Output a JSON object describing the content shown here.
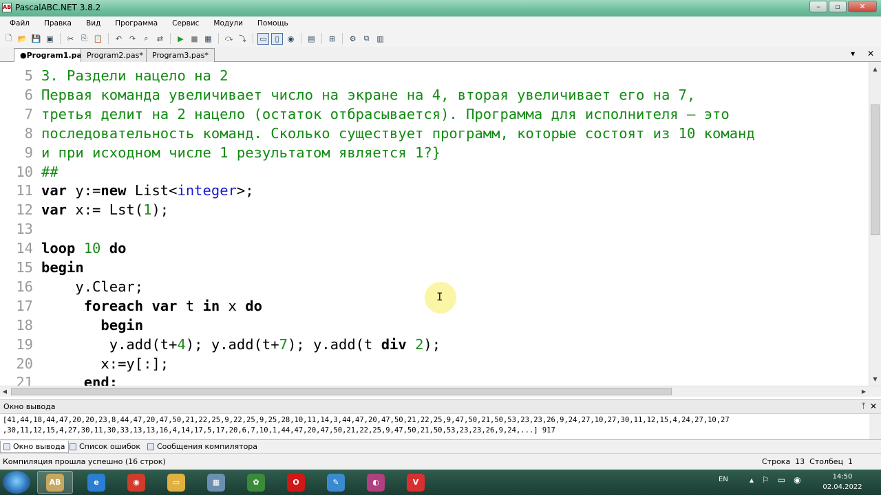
{
  "window": {
    "title": "PascalABC.NET 3.8.2",
    "app_icon_text": "AB",
    "min": "–",
    "max": "▫",
    "close": "✕"
  },
  "menu": [
    "Файл",
    "Правка",
    "Вид",
    "Программа",
    "Сервис",
    "Модули",
    "Помощь"
  ],
  "toolbar_icons": [
    "new-file-icon",
    "open-file-icon",
    "save-icon",
    "save-all-icon",
    "cut-icon",
    "copy-icon",
    "paste-icon",
    "undo-icon",
    "redo-icon",
    "find-icon",
    "replace-icon",
    "run-icon",
    "stop-icon",
    "debug-icon",
    "step-over-icon",
    "step-into-icon",
    "step-out-icon",
    "breakpoint-icon",
    "compile-icon",
    "format-icon",
    "settings-icon",
    "windows-icon",
    "help-icon"
  ],
  "tabs": [
    {
      "label": "●Program1.pas*",
      "active": true
    },
    {
      "label": "Program2.pas*",
      "active": false
    },
    {
      "label": "Program3.pas*",
      "active": false
    }
  ],
  "editor": {
    "lines": [
      {
        "n": "5",
        "segments": [
          {
            "t": "3. Раздели нацело на 2",
            "c": "cm"
          }
        ]
      },
      {
        "n": "6",
        "segments": [
          {
            "t": "Первая команда увеличивает число на экране на 4, вторая увеличивает его на 7,",
            "c": "cm"
          }
        ]
      },
      {
        "n": "7",
        "segments": [
          {
            "t": "третья делит на 2 нацело (остаток отбрасывается). Программа для исполнителя – это",
            "c": "cm"
          }
        ]
      },
      {
        "n": "8",
        "segments": [
          {
            "t": "последовательность команд. Сколько существует программ, которые состоят из 10 команд",
            "c": "cm"
          }
        ]
      },
      {
        "n": "9",
        "segments": [
          {
            "t": "и при исходном числе 1 результатом является 1?}",
            "c": "cm"
          }
        ]
      },
      {
        "n": "10",
        "segments": [
          {
            "t": "##",
            "c": "cm"
          }
        ]
      },
      {
        "n": "11",
        "segments": [
          {
            "t": "var",
            "c": "kw"
          },
          {
            "t": " y:=",
            "c": ""
          },
          {
            "t": "new",
            "c": "kw"
          },
          {
            "t": " List<",
            "c": ""
          },
          {
            "t": "integer",
            "c": "ty"
          },
          {
            "t": ">;",
            "c": ""
          }
        ]
      },
      {
        "n": "12",
        "segments": [
          {
            "t": "var",
            "c": "kw"
          },
          {
            "t": " x:= Lst(",
            "c": ""
          },
          {
            "t": "1",
            "c": "num"
          },
          {
            "t": ");",
            "c": ""
          }
        ]
      },
      {
        "n": "13",
        "segments": []
      },
      {
        "n": "14",
        "segments": [
          {
            "t": "loop",
            "c": "kw"
          },
          {
            "t": " ",
            "c": ""
          },
          {
            "t": "10",
            "c": "num"
          },
          {
            "t": " ",
            "c": ""
          },
          {
            "t": "do",
            "c": "kw"
          }
        ]
      },
      {
        "n": "15",
        "segments": [
          {
            "t": "begin",
            "c": "kw"
          }
        ]
      },
      {
        "n": "16",
        "segments": [
          {
            "t": "    y.Clear;",
            "c": ""
          }
        ]
      },
      {
        "n": "17",
        "segments": [
          {
            "t": "     ",
            "c": ""
          },
          {
            "t": "foreach",
            "c": "kw"
          },
          {
            "t": " ",
            "c": ""
          },
          {
            "t": "var",
            "c": "kw"
          },
          {
            "t": " t ",
            "c": ""
          },
          {
            "t": "in",
            "c": "kw"
          },
          {
            "t": " x ",
            "c": ""
          },
          {
            "t": "do",
            "c": "kw"
          }
        ]
      },
      {
        "n": "18",
        "segments": [
          {
            "t": "       ",
            "c": ""
          },
          {
            "t": "begin",
            "c": "kw"
          }
        ]
      },
      {
        "n": "19",
        "segments": [
          {
            "t": "        y.add(t+",
            "c": ""
          },
          {
            "t": "4",
            "c": "num"
          },
          {
            "t": "); y.add(t+",
            "c": ""
          },
          {
            "t": "7",
            "c": "num"
          },
          {
            "t": "); y.add(t ",
            "c": ""
          },
          {
            "t": "div",
            "c": "kw"
          },
          {
            "t": " ",
            "c": ""
          },
          {
            "t": "2",
            "c": "num"
          },
          {
            "t": ");",
            "c": ""
          }
        ]
      },
      {
        "n": "20",
        "segments": [
          {
            "t": "       x:=y[:];",
            "c": ""
          }
        ]
      },
      {
        "n": "21",
        "segments": [
          {
            "t": "     ",
            "c": ""
          },
          {
            "t": "end;",
            "c": "kw"
          }
        ]
      }
    ]
  },
  "output": {
    "title": "Окно вывода",
    "pin": "ᛘ",
    "close": "✕",
    "lines": [
      "[41,44,18,44,47,20,20,23,8,44,47,20,47,50,21,22,25,9,22,25,9,25,28,10,11,14,3,44,47,20,47,50,21,22,25,9,47,50,21,50,53,23,23,26,9,24,27,10,27,30,11,12,15,4,24,27,10,27",
      ",30,11,12,15,4,27,30,11,30,33,13,13,16,4,14,17,5,17,20,6,7,10,1,44,47,20,47,50,21,22,25,9,47,50,21,50,53,23,23,26,9,24,...] 917"
    ]
  },
  "bottom_tabs": [
    {
      "label": "Окно вывода",
      "active": true
    },
    {
      "label": "Список ошибок",
      "active": false
    },
    {
      "label": "Сообщения компилятора",
      "active": false
    }
  ],
  "status": {
    "message": "Компиляция прошла успешно (16 строк)",
    "position": "Строка  13  Столбец  1"
  },
  "taskbar": {
    "lang": "EN",
    "time": "14:50",
    "date": "02.04.2022",
    "apps": [
      {
        "name": "pascalabc-icon",
        "label": "AB",
        "color": "#c8a860",
        "active": true
      },
      {
        "name": "ie-icon",
        "label": "e",
        "color": "#2a7fd4",
        "active": false
      },
      {
        "name": "chrome-icon",
        "label": "◉",
        "color": "#d23a2a",
        "active": false
      },
      {
        "name": "explorer-icon",
        "label": "▭",
        "color": "#e0b040",
        "active": false
      },
      {
        "name": "calculator-icon",
        "label": "▦",
        "color": "#6a8fb0",
        "active": false
      },
      {
        "name": "turtle-icon",
        "label": "✿",
        "color": "#3a8a3a",
        "active": false
      },
      {
        "name": "opera-icon",
        "label": "O",
        "color": "#d01818",
        "active": false
      },
      {
        "name": "paint-icon",
        "label": "✎",
        "color": "#3a8ad0",
        "active": false
      },
      {
        "name": "color-app-icon",
        "label": "◐",
        "color": "#b04080",
        "active": false
      },
      {
        "name": "vivaldi-icon",
        "label": "V",
        "color": "#d83030",
        "active": false
      }
    ]
  }
}
